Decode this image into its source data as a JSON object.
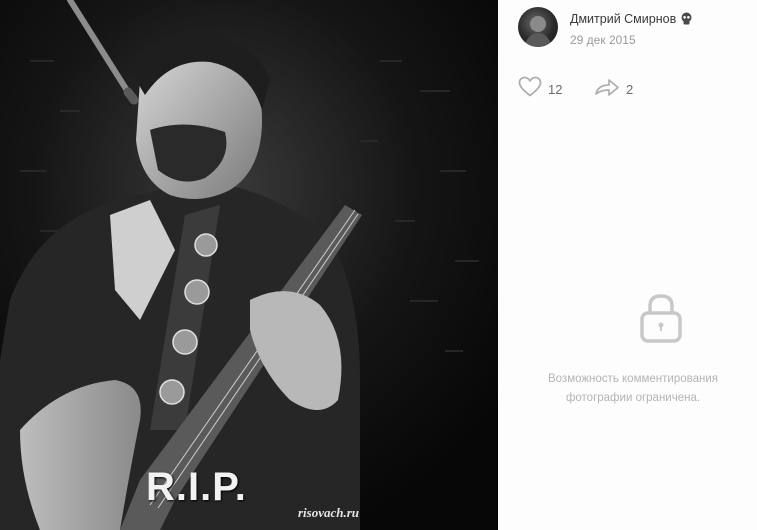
{
  "post": {
    "author_name": "Дмитрий Смирнов",
    "date": "29 дек 2015"
  },
  "photo": {
    "caption_overlay": "R.I.P.",
    "watermark": "risovach.ru"
  },
  "actions": {
    "likes_count": "12",
    "shares_count": "2"
  },
  "comments": {
    "restricted_line1": "Возможность комментирования",
    "restricted_line2": "фотографии ограничена."
  },
  "icons": {
    "like": "heart-icon",
    "share": "share-arrow-icon",
    "lock": "lock-icon",
    "badge": "skull-icon"
  },
  "colors": {
    "text_main": "#3a3a3a",
    "text_muted": "#9a9a9a",
    "icon_gray": "#b0b0b0",
    "photo_bg": "#0b0b0b"
  }
}
